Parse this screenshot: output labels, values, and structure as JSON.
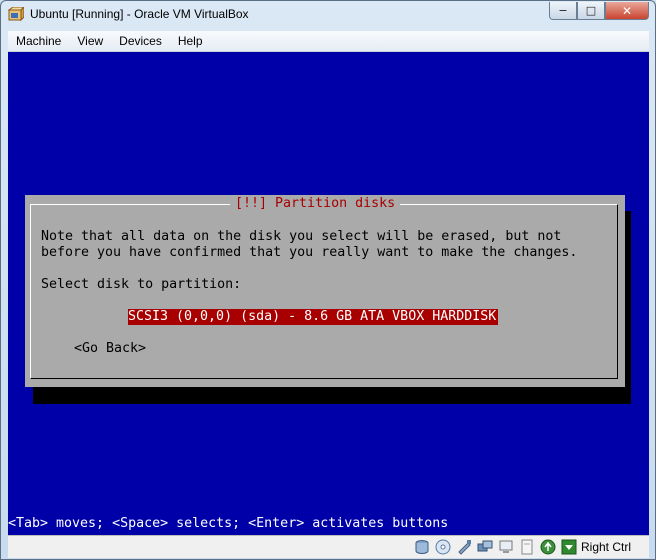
{
  "window": {
    "title": "Ubuntu [Running] - Oracle VM VirtualBox",
    "minimize": "−",
    "maximize": "□",
    "close": "✕"
  },
  "menu": {
    "items": [
      {
        "label": "Machine"
      },
      {
        "label": "View"
      },
      {
        "label": "Devices"
      },
      {
        "label": "Help"
      }
    ]
  },
  "installer": {
    "dialog_title_open": "[!!]",
    "dialog_title": " Partition disks",
    "note_line1": "Note that all data on the disk you select will be erased, but not",
    "note_line2": "before you have confirmed that you really want to make the changes.",
    "prompt": "Select disk to partition:",
    "disk_option": "SCSI3 (0,0,0) (sda) - 8.6 GB ATA VBOX HARDDISK",
    "go_back": "<Go Back>",
    "key_hint": "<Tab> moves; <Space> selects; <Enter> activates buttons"
  },
  "statusbar": {
    "icons": [
      "hard-disk-icon",
      "optical-drive-icon",
      "usb-icon",
      "shared-folders-icon",
      "network-icon",
      "capture-icon",
      "mouse-integration-icon",
      "host-key-icon"
    ],
    "host_key": "Right Ctrl"
  },
  "colors": {
    "screen_bg": "#0000a8",
    "dialog_bg": "#aaaaaa",
    "highlight": "#a80000"
  }
}
